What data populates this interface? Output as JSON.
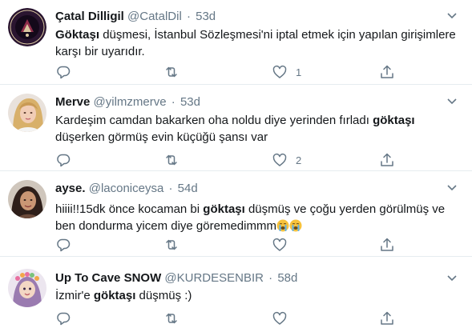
{
  "tweets": [
    {
      "name": "Çatal Dilligil",
      "handle": "@CatalDil",
      "time": "53d",
      "text_before": "",
      "highlight": "Göktaşı",
      "text_after": " düşmesi, İstanbul Sözleşmesi'ni iptal etmek için yapılan girişimlere karşı bir uyarıdır.",
      "reply_count": "",
      "retweet_count": "",
      "like_count": "1",
      "avatar_icon": "avatar-logo"
    },
    {
      "name": "Merve",
      "handle": "@yilmzmerve",
      "time": "53d",
      "text_before": "Kardeşim camdan bakarken oha noldu diye yerinden fırladı ",
      "highlight": "göktaşı",
      "text_after": " düşerken görmüş evin küçüğü şansı var",
      "reply_count": "",
      "retweet_count": "",
      "like_count": "2",
      "avatar_icon": "avatar-photo"
    },
    {
      "name": "ayse.",
      "handle": "@laconiceysa",
      "time": "54d",
      "text_before": "hiiii!!15dk önce kocaman bi ",
      "highlight": "göktaşı",
      "text_after": " düşmüş ve çoğu yerden görülmüş ve ben dondurma yicem diye göremedimmm",
      "reply_count": "",
      "retweet_count": "",
      "like_count": "",
      "avatar_icon": "avatar-photo"
    },
    {
      "name": "Up To Cave SNOW",
      "handle": "@KURDESENBIR",
      "time": "58d",
      "text_before": "İzmir'e ",
      "highlight": "göktaşı",
      "text_after": " düşmüş :)",
      "reply_count": "",
      "retweet_count": "",
      "like_count": "",
      "avatar_icon": "avatar-illustration"
    }
  ],
  "icons": {
    "reply": "reply-icon",
    "retweet": "retweet-icon",
    "like": "heart-icon",
    "share": "share-icon",
    "more": "chevron-down-icon",
    "emoji": "loudly-crying-face-emoji"
  },
  "colors": {
    "name": "#14171a",
    "secondary": "#657786",
    "divider": "#e6ecf0",
    "background": "#ffffff"
  }
}
